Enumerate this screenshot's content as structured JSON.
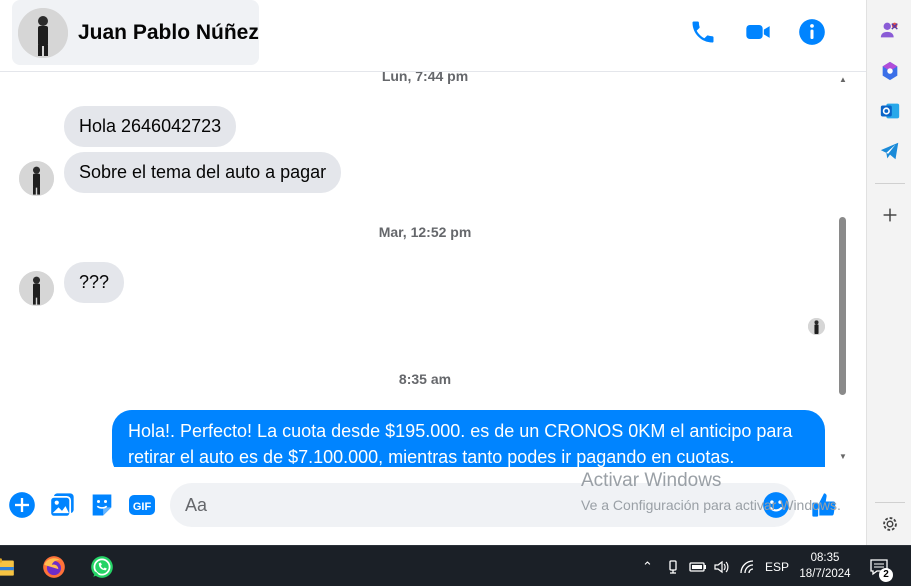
{
  "header": {
    "contact_name": "Juan Pablo Núñez",
    "icons": [
      "phone-icon",
      "video-call-icon",
      "info-icon"
    ],
    "accent_color": "#0084ff"
  },
  "messages": {
    "timestamp_1": "Lun, 7:44 pm",
    "in_1": "Hola 2646042723",
    "in_2": "Sobre el tema del auto a pagar",
    "timestamp_2": "Mar, 12:52 pm",
    "in_3": "???",
    "timestamp_3": "8:35 am",
    "out_1": "Hola!. Perfecto! La cuota desde $195.000. es de un CRONOS 0KM el anticipo para retirar el auto es de $7.100.000, mientras tanto podes ir pagando en cuotas."
  },
  "composer": {
    "placeholder": "Aa",
    "gif_label": "GIF",
    "icons": [
      "add-icon",
      "photo-icon",
      "sticker-icon",
      "gif-icon",
      "emoji-icon",
      "like-icon"
    ]
  },
  "watermark": {
    "line1": "Activar Windows",
    "line2": "Ve a Configuración para activar Windows."
  },
  "sidebar": {
    "icons": [
      "people-icon",
      "copilot-icon",
      "outlook-icon",
      "telegram-icon",
      "add-icon",
      "settings-icon"
    ]
  },
  "taskbar": {
    "language": "ESP",
    "time": "08:35",
    "date": "18/7/2024",
    "notification_count": "2",
    "apps": [
      "file-explorer-icon",
      "firefox-icon",
      "whatsapp-icon"
    ]
  }
}
